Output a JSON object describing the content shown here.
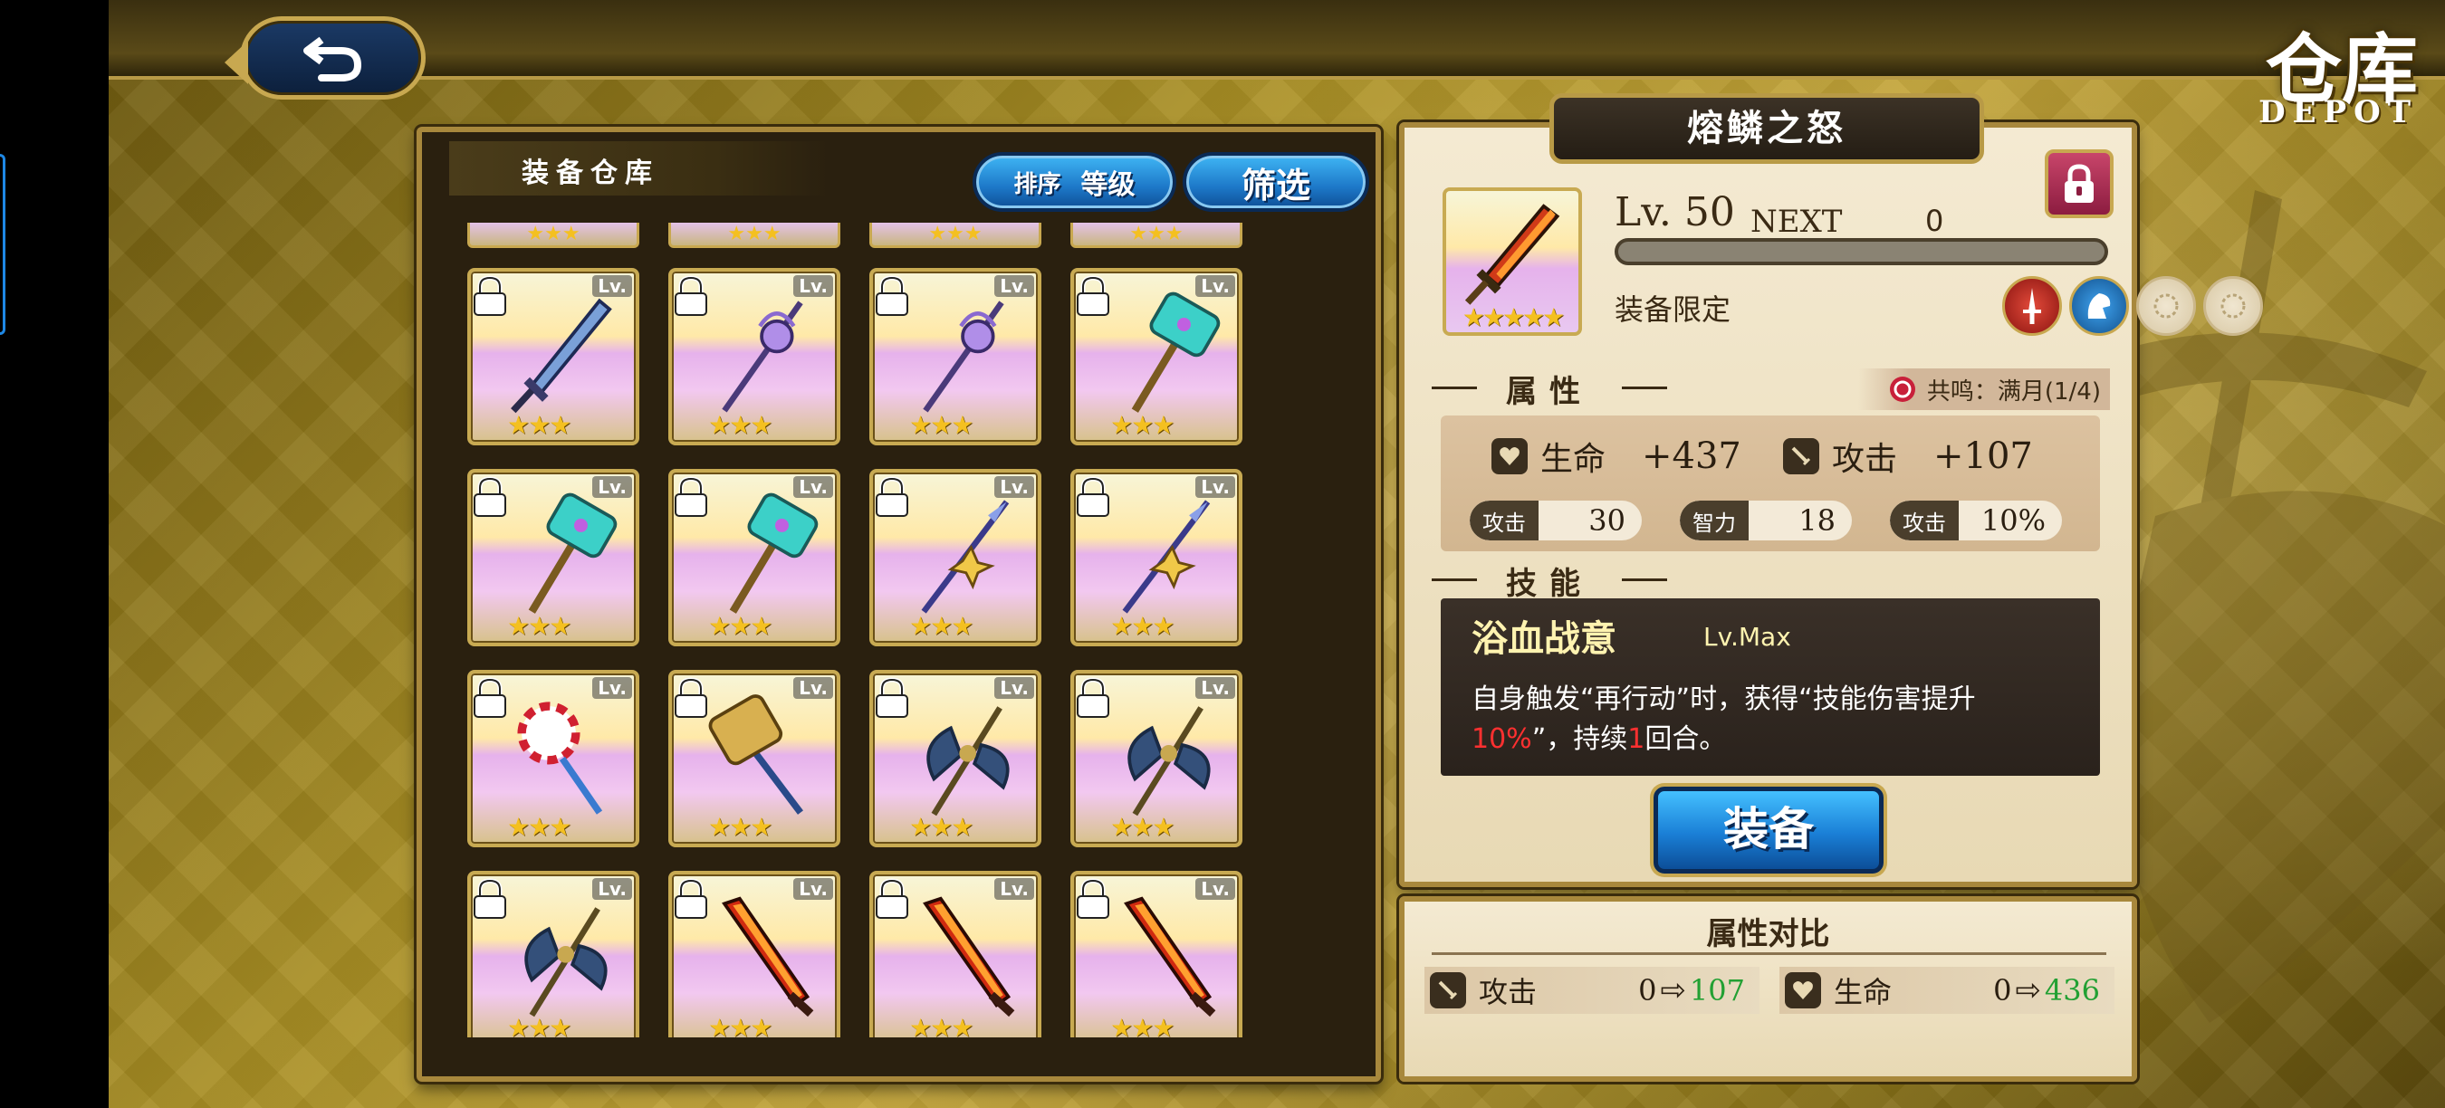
{
  "header": {
    "title_cn": "仓库",
    "title_en": "DEPOT"
  },
  "inventory": {
    "title": "装备仓库",
    "sort_label": "排序",
    "sort_value": "等级",
    "filter_label": "筛选",
    "lv_tag": "Lv.",
    "items": [
      {
        "weapon": "sword-blue",
        "stars": 3
      },
      {
        "weapon": "staff-purple",
        "stars": 3
      },
      {
        "weapon": "staff-purple",
        "stars": 3
      },
      {
        "weapon": "hammer-crystal",
        "stars": 3
      },
      {
        "weapon": "hammer-crystal",
        "stars": 3
      },
      {
        "weapon": "hammer-crystal",
        "stars": 3
      },
      {
        "weapon": "spear-star",
        "stars": 3
      },
      {
        "weapon": "spear-star",
        "stars": 3
      },
      {
        "weapon": "candy-staff",
        "stars": 3
      },
      {
        "weapon": "gold-hammer",
        "stars": 3
      },
      {
        "weapon": "axe-dark",
        "stars": 3
      },
      {
        "weapon": "axe-dark",
        "stars": 3
      },
      {
        "weapon": "axe-dark",
        "stars": 3
      },
      {
        "weapon": "flame-sword",
        "stars": 3
      },
      {
        "weapon": "flame-sword",
        "stars": 3
      },
      {
        "weapon": "flame-sword",
        "stars": 3
      }
    ]
  },
  "detail": {
    "name": "熔鳞之怒",
    "level": "Lv. 50",
    "next_label": "NEXT",
    "next_value": "0",
    "exp_progress": 0,
    "icon_stars": "★★★★★",
    "equip_limit_label": "装备限定",
    "attributes_header": "属性",
    "resonance_text": "共鸣：满月(1/4)",
    "main_stats": [
      {
        "label": "生命",
        "value": "+437",
        "icon": "heart-icon"
      },
      {
        "label": "攻击",
        "value": "+107",
        "icon": "sword-icon"
      }
    ],
    "sub_stats": [
      {
        "tag": "攻击",
        "value": "30"
      },
      {
        "tag": "智力",
        "value": "18"
      },
      {
        "tag": "攻击",
        "value": "10%"
      }
    ],
    "skill_header": "技能",
    "skill_name": "浴血战意",
    "skill_level": "Lv.Max",
    "skill_desc_1": "自身触发“再行动”时，获得“技能伤害提升",
    "skill_desc_2a": "10%",
    "skill_desc_2b": "”，持续",
    "skill_desc_2c": "1",
    "skill_desc_2d": "回合。",
    "equip_button": "装备"
  },
  "compare": {
    "title": "属性对比",
    "rows": [
      {
        "label": "攻击",
        "from": "0",
        "to": "107",
        "icon": "sword-icon"
      },
      {
        "label": "生命",
        "from": "0",
        "to": "436",
        "icon": "heart-icon"
      }
    ],
    "arrow": "⇨"
  },
  "colors": {
    "accent_gold": "#c8a850",
    "button_blue": "#1d78c8",
    "increase_green": "#22a033",
    "highlight_red": "#ff3030"
  }
}
